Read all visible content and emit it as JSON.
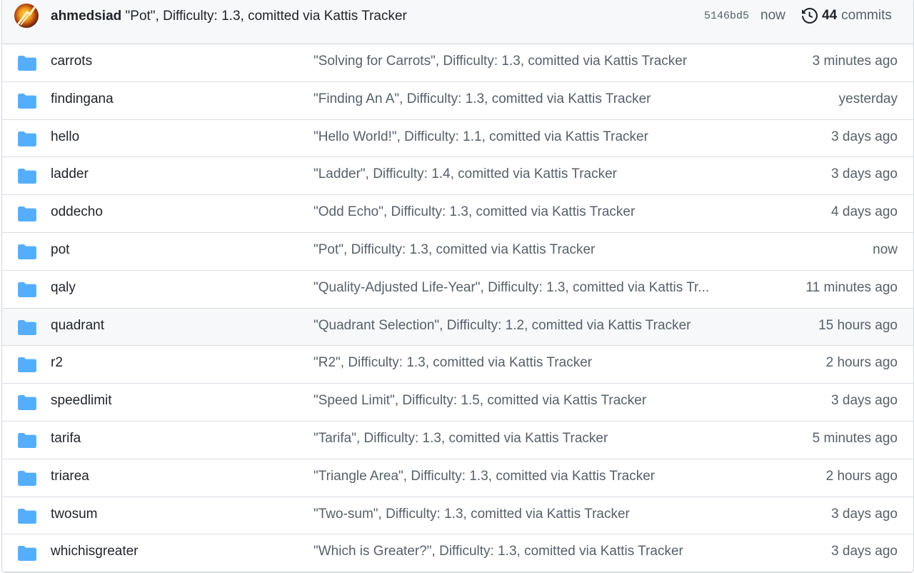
{
  "latest_commit": {
    "author": "ahmedsiad",
    "message": "\"Pot\", Difficulty: 1.3, comitted via Kattis Tracker",
    "hash": "5146bd5",
    "time": "now",
    "commit_count": "44",
    "commits_label": "commits"
  },
  "files": [
    {
      "name": "carrots",
      "message": "\"Solving for Carrots\", Difficulty: 1.3, comitted via Kattis Tracker",
      "age": "3 minutes ago"
    },
    {
      "name": "findingana",
      "message": "\"Finding An A\", Difficulty: 1.3, comitted via Kattis Tracker",
      "age": "yesterday"
    },
    {
      "name": "hello",
      "message": "\"Hello World!\", Difficulty: 1.1, comitted via Kattis Tracker",
      "age": "3 days ago"
    },
    {
      "name": "ladder",
      "message": "\"Ladder\", Difficulty: 1.4, comitted via Kattis Tracker",
      "age": "3 days ago"
    },
    {
      "name": "oddecho",
      "message": "\"Odd Echo\", Difficulty: 1.3, comitted via Kattis Tracker",
      "age": "4 days ago"
    },
    {
      "name": "pot",
      "message": "\"Pot\", Difficulty: 1.3, comitted via Kattis Tracker",
      "age": "now"
    },
    {
      "name": "qaly",
      "message": "\"Quality-Adjusted Life-Year\", Difficulty: 1.3, comitted via Kattis Tr...",
      "age": "11 minutes ago"
    },
    {
      "name": "quadrant",
      "message": "\"Quadrant Selection\", Difficulty: 1.2, comitted via Kattis Tracker",
      "age": "15 hours ago"
    },
    {
      "name": "r2",
      "message": "\"R2\", Difficulty: 1.3, comitted via Kattis Tracker",
      "age": "2 hours ago"
    },
    {
      "name": "speedlimit",
      "message": "\"Speed Limit\", Difficulty: 1.5, comitted via Kattis Tracker",
      "age": "3 days ago"
    },
    {
      "name": "tarifa",
      "message": "\"Tarifa\", Difficulty: 1.3, comitted via Kattis Tracker",
      "age": "5 minutes ago"
    },
    {
      "name": "triarea",
      "message": "\"Triangle Area\", Difficulty: 1.3, comitted via Kattis Tracker",
      "age": "2 hours ago"
    },
    {
      "name": "twosum",
      "message": "\"Two-sum\", Difficulty: 1.3, comitted via Kattis Tracker",
      "age": "3 days ago"
    },
    {
      "name": "whichisgreater",
      "message": "\"Which is Greater?\", Difficulty: 1.3, comitted via Kattis Tracker",
      "age": "3 days ago"
    }
  ],
  "icons": {
    "row": "folder-icon",
    "history": "history-icon"
  },
  "colors": {
    "folder": "#54aeff",
    "hover_row": "#f6f8fa",
    "muted_text": "#57606a"
  }
}
